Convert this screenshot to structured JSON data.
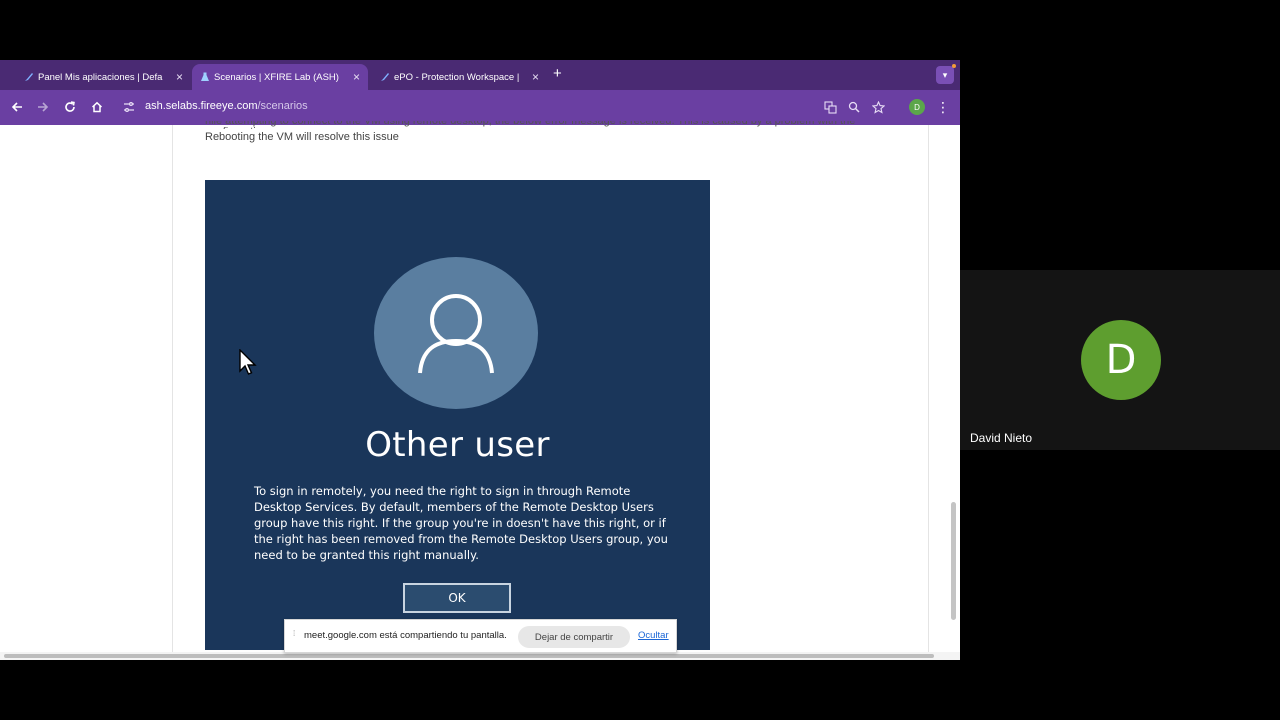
{
  "browser": {
    "tabs": [
      {
        "title": "Panel Mis aplicaciones | Defa",
        "close": "×",
        "active": false
      },
      {
        "title": "Scenarios | XFIRE Lab (ASH)",
        "close": "×",
        "active": true
      },
      {
        "title": "ePO - Protection Workspace |",
        "close": "×",
        "active": false
      }
    ],
    "new_tab": "+",
    "url": {
      "domain": "ash.selabs.fireeye.com",
      "path": "/scenarios"
    },
    "profile_initial": "D",
    "colors": {
      "tabbar": "#4a2a73",
      "toolbar": "#6a3fa2"
    }
  },
  "page": {
    "cut_text": "hile attempting to connect to the VM using remote desktop, the below error message is received. This is caused by a problem with the configuration.",
    "body_text": "Rebooting the VM will resolve this issue"
  },
  "rdp_dialog": {
    "title": "Other user",
    "message": "To sign in remotely, you need the right to sign in through Remote Desktop Services. By default, members of the Remote Desktop Users group have this right. If the group you're in doesn't have this right, or if the right has been removed from the Remote Desktop Users group, you need to be granted this right manually.",
    "ok_label": "OK",
    "colors": {
      "background": "#1a365a",
      "avatar": "#5a7ea0"
    }
  },
  "share_bar": {
    "text": "meet.google.com está compartiendo tu pantalla.",
    "stop_label": "Dejar de compartir",
    "hide_label": "Ocultar"
  },
  "participant": {
    "initial": "D",
    "name": "David Nieto",
    "avatar_color": "#5e9e2f"
  }
}
